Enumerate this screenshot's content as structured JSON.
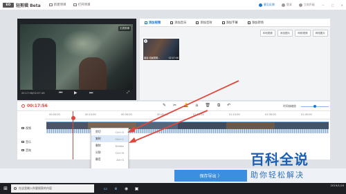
{
  "app": {
    "logo_mark": "EO",
    "title": "轻剪辑 Beta"
  },
  "menu": [
    {
      "label": "新建项目"
    },
    {
      "label": "打开项目"
    }
  ],
  "window_controls": {
    "feedback": "意见反馈",
    "register": "登录",
    "help": "立刻升级"
  },
  "preview": {
    "badge": "无损剪辑",
    "time": "00:17:56/02:07:46"
  },
  "library": {
    "tabs": [
      {
        "label": "添加视频",
        "active": true
      },
      {
        "label": "添加音乐"
      },
      {
        "label": "添加音效"
      },
      {
        "label": "添加字幕"
      },
      {
        "label": "添加转场"
      }
    ],
    "buttons": [
      {
        "label": "本地视频"
      },
      {
        "label": "添加图片"
      },
      {
        "label": "网络视频"
      },
      {
        "label": "网络图片"
      }
    ],
    "clip": {
      "name": "魔兽·动画视频…",
      "duration": "02:07:46"
    }
  },
  "editor": {
    "current_time": "00:17:56",
    "zoom_label": "时间轴缩放"
  },
  "timeline": {
    "ticks": [
      "00:00:00",
      "00:15:00",
      "00:30:00",
      "00:45:00",
      "01:00:00",
      "01:15:00",
      "01:30:00",
      "01:45:00"
    ],
    "tracks": [
      {
        "label": "视频"
      },
      {
        "label": "音乐"
      },
      {
        "label": "音效"
      }
    ]
  },
  "context_menu": [
    {
      "label": "剪切",
      "shortcut": "Ctrl+X"
    },
    {
      "label": "复制",
      "shortcut": "Ctrl+C"
    },
    {
      "label": "删除",
      "shortcut": "Delete"
    },
    {
      "label": "分割",
      "shortcut": "Ctrl+B"
    },
    {
      "label": "静音",
      "shortcut": "Alt+S"
    }
  ],
  "export": {
    "label": "保存导出 〉"
  },
  "taskbar": {
    "search_placeholder": "在这里输入你要搜索的内容",
    "date": "2019/1/16"
  },
  "watermark": {
    "line1": "百科全说",
    "line2": "助你轻松解决"
  },
  "colors": {
    "accent": "#1677d2",
    "playhead": "#e0473c",
    "export": "#3c8fe0"
  }
}
